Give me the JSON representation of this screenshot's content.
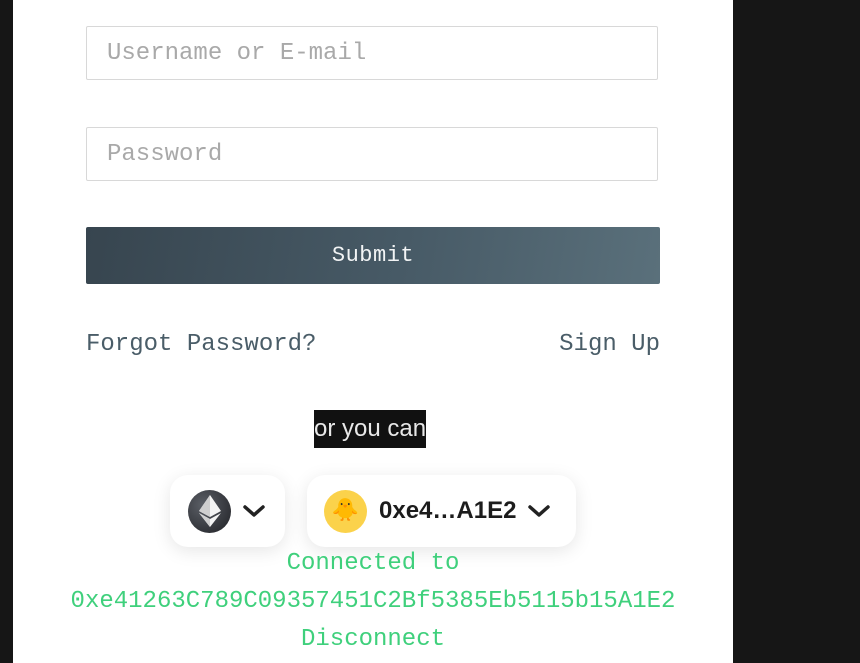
{
  "login_form": {
    "username_placeholder": "Username or E-mail",
    "password_placeholder": "Password",
    "submit_label": "Submit",
    "forgot_password_label": "Forgot Password?",
    "sign_up_label": "Sign Up"
  },
  "divider_text": "or you can",
  "wallet": {
    "chain_icon": "ethereum-icon",
    "account_avatar": "🐥",
    "account_short": "0xe4…A1E2",
    "connected_label": "Connected to",
    "full_address": "0xe41263C789C09357451C2Bf5385Eb5115b15A1E2",
    "disconnect_label": "Disconnect"
  },
  "colors": {
    "page_background": "#161616",
    "submit_gradient_start": "#37454f",
    "submit_gradient_end": "#5a707b",
    "link_color": "#4a5d68",
    "connected_text": "#3fd07c",
    "avatar_background": "#fbd24b"
  }
}
